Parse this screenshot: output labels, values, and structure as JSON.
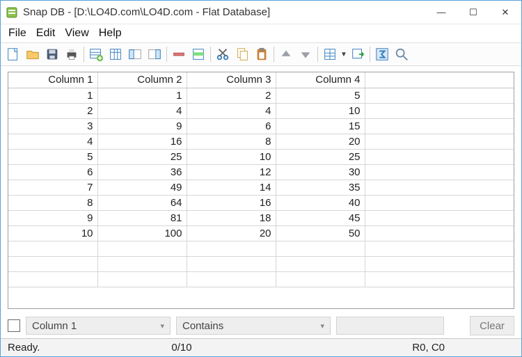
{
  "window": {
    "title": "Snap DB - [D:\\LO4D.com\\LO4D.com - Flat Database]",
    "minimize": "—",
    "maximize": "☐",
    "close": "✕"
  },
  "menu": {
    "file": "File",
    "edit": "Edit",
    "view": "View",
    "help": "Help"
  },
  "toolbar": {
    "icons": {
      "new": "new-icon",
      "open": "open-icon",
      "save": "save-icon",
      "print": "print-icon",
      "addrow": "add-row-icon",
      "cols": "columns-icon",
      "insert": "insert-left-icon",
      "insert2": "insert-right-icon",
      "delrow": "delete-row-icon",
      "highlight": "highlight-icon",
      "cut": "cut-icon",
      "copy": "copy-icon",
      "paste": "paste-icon",
      "up": "move-up-icon",
      "down": "move-down-icon",
      "gridopt": "grid-options-icon",
      "export": "export-icon",
      "sum": "sum-icon",
      "find": "find-icon"
    }
  },
  "grid": {
    "headers": [
      "Column 1",
      "Column 2",
      "Column 3",
      "Column 4"
    ],
    "rows": [
      [
        1,
        1,
        2,
        5
      ],
      [
        2,
        4,
        4,
        10
      ],
      [
        3,
        9,
        6,
        15
      ],
      [
        4,
        16,
        8,
        20
      ],
      [
        5,
        25,
        10,
        25
      ],
      [
        6,
        36,
        12,
        30
      ],
      [
        7,
        49,
        14,
        35
      ],
      [
        8,
        64,
        16,
        40
      ],
      [
        9,
        81,
        18,
        45
      ],
      [
        10,
        100,
        20,
        50
      ]
    ]
  },
  "filter": {
    "column_select": "Column 1",
    "condition_select": "Contains",
    "value": "",
    "clear": "Clear"
  },
  "status": {
    "ready": "Ready.",
    "count": "0/10",
    "cursor": "R0, C0"
  }
}
